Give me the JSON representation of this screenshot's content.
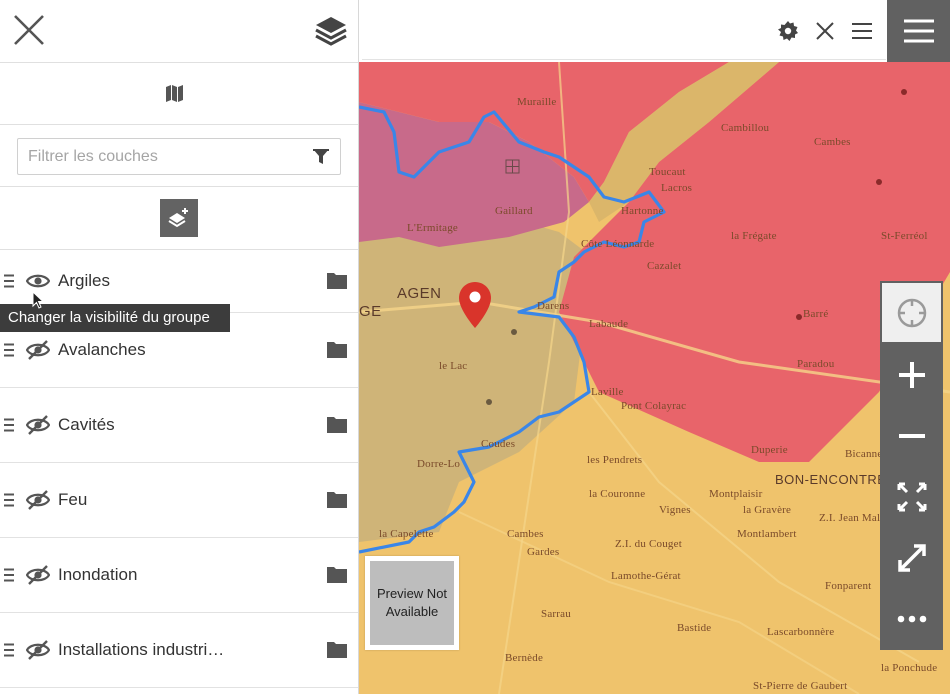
{
  "panel": {
    "filter_placeholder": "Filtrer les couches",
    "layers": [
      {
        "name": "Argiles",
        "visible": true
      },
      {
        "name": "Avalanches",
        "visible": false
      },
      {
        "name": "Cavités",
        "visible": false
      },
      {
        "name": "Feu",
        "visible": false
      },
      {
        "name": "Inondation",
        "visible": false
      },
      {
        "name": "Installations industri…",
        "visible": false
      }
    ],
    "tooltip": "Changer la visibilité du groupe"
  },
  "map": {
    "places": {
      "muraille": "Muraille",
      "cambillou": "Cambillou",
      "cambes_north": "Cambes",
      "toucaut": "Toucaut",
      "lacros": "Lacros",
      "gaillard": "Gaillard",
      "lermitage": "L'Ermitage",
      "hartonne": "Hartonne",
      "coteleon": "Côte Léonnarde",
      "lafregate": "la Frégate",
      "stferreol": "St-Ferréol",
      "cazalet": "Cazalet",
      "agen": "AGEN",
      "ge": "GE",
      "darens": "Darens",
      "labaude": "Labaude",
      "barre": "Barré",
      "paradou": "Paradou",
      "lelac": "le Lac",
      "laville": "Laville",
      "pontcolayrac": "Pont Colayrac",
      "duperie": "Duperie",
      "bonencontre": "BON-ENCONTRE",
      "bicanne": "Bicanne",
      "lespendrets": "les Pendrets",
      "montplaisir": "Montplaisir",
      "lacouronne": "la Couronne",
      "lagraviere": "la Gravère",
      "vignes": "Vignes",
      "dorrelo": "Dorre-Lo",
      "coudes": "Coudes",
      "cambes_south": "Cambes",
      "gardes": "Gardes",
      "zicouget": "Z.I. du Couget",
      "montlambert": "Montlambert",
      "lacapelette": "la Capelette",
      "lamothegerat": "Lamothe-Gérat",
      "fonparent": "Fonparent",
      "sarrau": "Sarrau",
      "bastide": "Bastide",
      "lascarbonnere": "Lascarbonnère",
      "bernede": "Bernède",
      "laponchude": "la Ponchude",
      "stpierre": "St-Pierre de Gaubert",
      "zi_small": "Z.I. Jean Malèze"
    },
    "zones": {
      "red": "#e8646a",
      "pink": "#c86a8a",
      "orange": "#efc36c",
      "olive": "#c9b27a",
      "boundary": "#3a86e8",
      "marker": "#d9342b"
    }
  },
  "preview": {
    "line1": "Preview Not",
    "line2": "Available"
  }
}
